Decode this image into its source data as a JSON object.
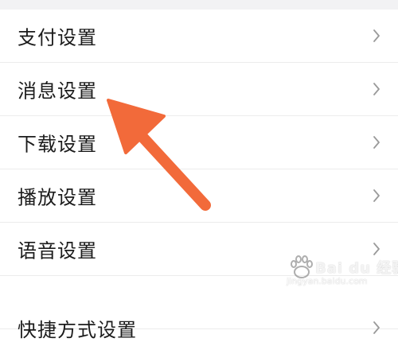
{
  "settings_menu": {
    "items": [
      {
        "label": "支付设置"
      },
      {
        "label": "消息设置"
      },
      {
        "label": "下载设置"
      },
      {
        "label": "播放设置"
      },
      {
        "label": "语音设置"
      },
      {
        "label": "快捷方式设置"
      }
    ]
  },
  "icons": {
    "row_chevron": "chevron-right-icon",
    "annotation_arrow": "arrow-pointer-icon"
  },
  "colors": {
    "text": "#1b1b1b",
    "chevron": "#9a9a9a",
    "divider": "#ececec",
    "arrow": "#f26a3a"
  },
  "watermark": {
    "brand": "Bai du 经验",
    "url": "jingyan.baidu.com"
  }
}
